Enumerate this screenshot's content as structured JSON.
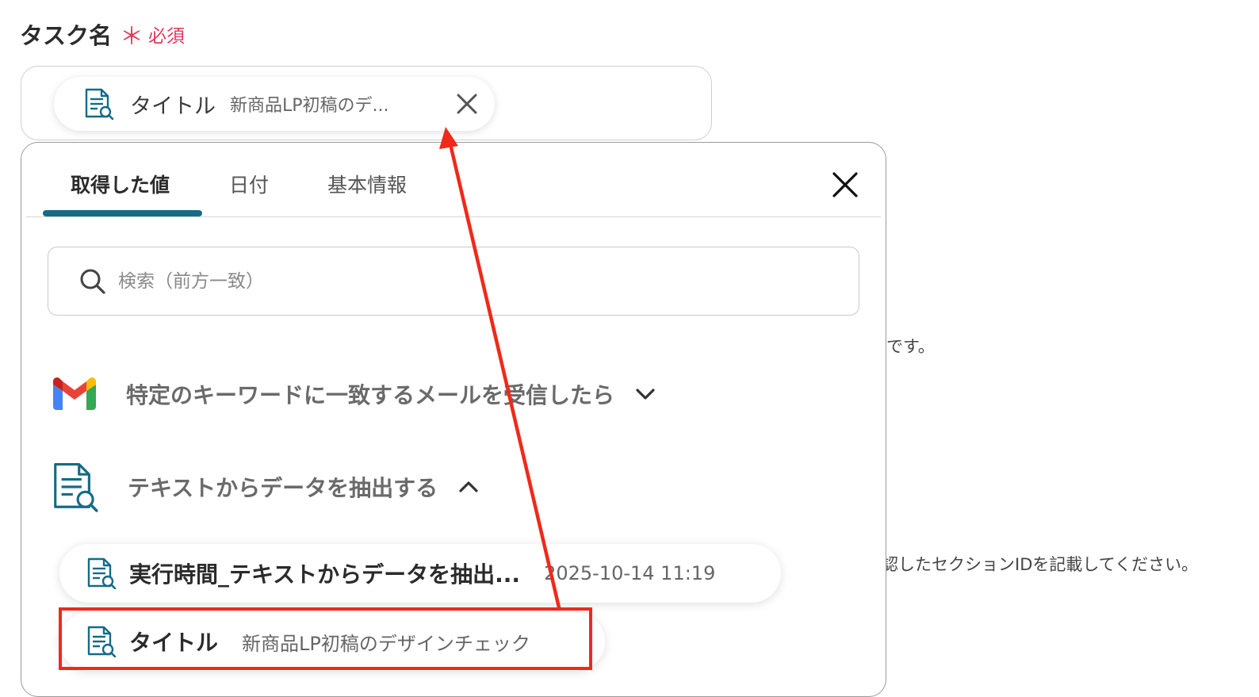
{
  "field": {
    "label": "タスク名",
    "required_mark": "＊",
    "required_text": "必須"
  },
  "selected_chip": {
    "name": "タイトル",
    "value": "新商品LP初稿のデ..."
  },
  "background_text": {
    "line1": "です。",
    "line2": "認したセクションIDを記載してください。"
  },
  "panel": {
    "tabs": [
      {
        "label": "取得した値",
        "active": true
      },
      {
        "label": "日付",
        "active": false
      },
      {
        "label": "基本情報",
        "active": false
      }
    ],
    "search": {
      "placeholder": "検索（前方一致）",
      "value": ""
    },
    "sections": [
      {
        "label": "特定のキーワードに一致するメールを受信したら",
        "icon": "gmail-icon",
        "expanded": false
      },
      {
        "label": "テキストからデータを抽出する",
        "icon": "text-extract-icon",
        "expanded": true
      }
    ],
    "items": [
      {
        "name": "実行時間_テキストからデータを抽出...",
        "value": "2025-10-14 11:19"
      },
      {
        "name": "タイトル",
        "value": "新商品LP初稿のデザインチェック"
      }
    ]
  },
  "colors": {
    "accent": "#156b86",
    "required": "#e5385a",
    "annotation": "#ee2a1a"
  }
}
